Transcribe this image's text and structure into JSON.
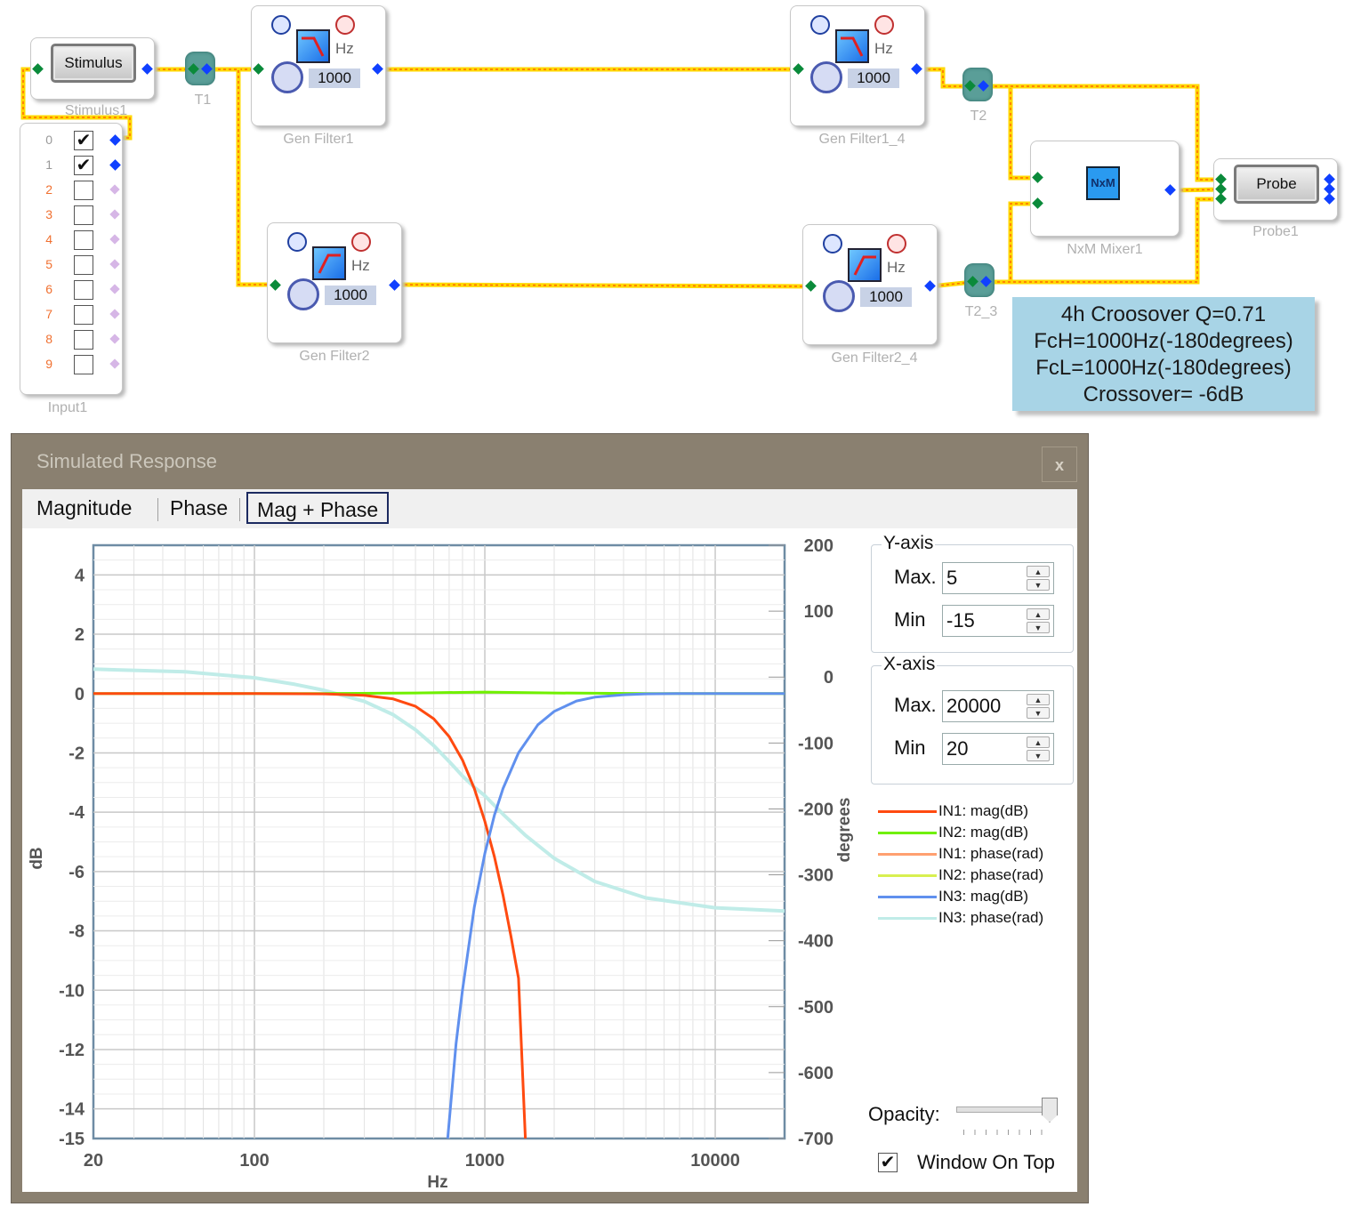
{
  "schematic": {
    "stimulus": {
      "button": "Stimulus",
      "label": "Stimulus1"
    },
    "tees": [
      {
        "label": "T1"
      },
      {
        "label": "T2"
      },
      {
        "label": "T2_3"
      }
    ],
    "filters": [
      {
        "label": "Gen Filter1",
        "hz_unit": "Hz",
        "value": "1000",
        "type": "lowpass"
      },
      {
        "label": "Gen Filter1_4",
        "hz_unit": "Hz",
        "value": "1000",
        "type": "lowpass"
      },
      {
        "label": "Gen Filter2",
        "hz_unit": "Hz",
        "value": "1000",
        "type": "highpass"
      },
      {
        "label": "Gen Filter2_4",
        "hz_unit": "Hz",
        "value": "1000",
        "type": "highpass"
      }
    ],
    "mixer": {
      "icon_text": "NxM",
      "label": "NxM Mixer1"
    },
    "probe": {
      "button": "Probe",
      "label": "Probe1"
    },
    "input": {
      "label": "Input1",
      "channels": [
        {
          "num": "0",
          "checked": true
        },
        {
          "num": "1",
          "checked": true
        },
        {
          "num": "2",
          "checked": false
        },
        {
          "num": "3",
          "checked": false
        },
        {
          "num": "4",
          "checked": false
        },
        {
          "num": "5",
          "checked": false
        },
        {
          "num": "6",
          "checked": false
        },
        {
          "num": "7",
          "checked": false
        },
        {
          "num": "8",
          "checked": false
        },
        {
          "num": "9",
          "checked": false
        }
      ],
      "check_mark": "✔"
    },
    "note": {
      "line1": "4h Croosover Q=0.71",
      "line2": "FcH=1000Hz(-180degrees)",
      "line3": "FcL=1000Hz(-180degrees)",
      "line4": "Crossover= -6dB"
    },
    "colors": {
      "wire": "#ffd800",
      "wire_dash": "#ff6a00",
      "port_in": "#0a8a3a",
      "port_out": "#1040ff"
    }
  },
  "window": {
    "title": "Simulated Response",
    "close": "x",
    "tabs": [
      {
        "label": "Magnitude",
        "active": false
      },
      {
        "label": "Phase",
        "active": false
      },
      {
        "label": "Mag + Phase",
        "active": true
      }
    ],
    "yaxis": {
      "title": "Y-axis",
      "max_label": "Max.",
      "max_value": "5",
      "min_label": "Min",
      "min_value": "-15"
    },
    "xaxis": {
      "title": "X-axis",
      "max_label": "Max.",
      "max_value": "20000",
      "min_label": "Min",
      "min_value": "20"
    },
    "opacity_label": "Opacity:",
    "opacity_value": 1.0,
    "window_on_top_label": "Window On Top",
    "window_on_top_checked": true,
    "check_mark": "✔"
  },
  "chart_data": {
    "type": "line",
    "xscale": "log",
    "xlim": [
      20,
      20000
    ],
    "ylim": [
      -15,
      5
    ],
    "y2lim": [
      -700,
      200
    ],
    "xlabel": "Hz",
    "ylabel": "dB",
    "y2label": "degrees",
    "xticks": [
      "20",
      "100",
      "1000",
      "10000"
    ],
    "yticks": [
      "4",
      "2",
      "0",
      "-2",
      "-4",
      "-6",
      "-8",
      "-10",
      "-12",
      "-14",
      "-15"
    ],
    "y2ticks": [
      "200",
      "100",
      "0",
      "-100",
      "-200",
      "-300",
      "-400",
      "-500",
      "-600",
      "-700"
    ],
    "grid": true,
    "legend_position": "right",
    "series": [
      {
        "name": "IN1: mag(dB)",
        "color": "#ff4a10",
        "axis": "left",
        "x": [
          20,
          100,
          200,
          300,
          400,
          500,
          600,
          700,
          800,
          900,
          1000,
          1100,
          1200,
          1300,
          1400,
          1500
        ],
        "y": [
          0,
          0,
          -0.01,
          -0.06,
          -0.18,
          -0.43,
          -0.85,
          -1.45,
          -2.24,
          -3.2,
          -4.3,
          -5.5,
          -6.8,
          -8.2,
          -9.6,
          -15
        ]
      },
      {
        "name": "IN2: mag(dB)",
        "color": "#70f000",
        "axis": "left",
        "x": [
          20,
          200,
          500,
          1000,
          2000,
          5000,
          20000
        ],
        "y": [
          0,
          0,
          0.02,
          0.05,
          0.02,
          0,
          0
        ]
      },
      {
        "name": "IN1: phase(rad)",
        "color": "#ffa070",
        "axis": "right",
        "x": [],
        "y": []
      },
      {
        "name": "IN2: phase(rad)",
        "color": "#d8f050",
        "axis": "right",
        "x": [],
        "y": []
      },
      {
        "name": "IN3: mag(dB)",
        "color": "#6090ee",
        "axis": "left",
        "x": [
          690,
          750,
          800,
          900,
          1000,
          1100,
          1200,
          1400,
          1700,
          2000,
          2500,
          3000,
          4000,
          5000,
          7000,
          20000
        ],
        "y": [
          -15,
          -11.8,
          -10.0,
          -7.2,
          -5.4,
          -4.1,
          -3.2,
          -2.0,
          -1.05,
          -0.6,
          -0.25,
          -0.12,
          -0.04,
          -0.01,
          0,
          0
        ]
      },
      {
        "name": "IN3: phase(rad)",
        "color": "#c0ece8",
        "axis": "right",
        "x": [
          20,
          50,
          100,
          150,
          200,
          300,
          400,
          500,
          600,
          700,
          800,
          900,
          1000,
          1200,
          1500,
          2000,
          3000,
          5000,
          10000,
          20000
        ],
        "y": [
          12,
          8,
          -1,
          -11,
          -20,
          -37,
          -57,
          -80,
          -104,
          -128,
          -150,
          -167,
          -180,
          -208,
          -240,
          -275,
          -310,
          -335,
          -350,
          -355
        ]
      }
    ]
  }
}
